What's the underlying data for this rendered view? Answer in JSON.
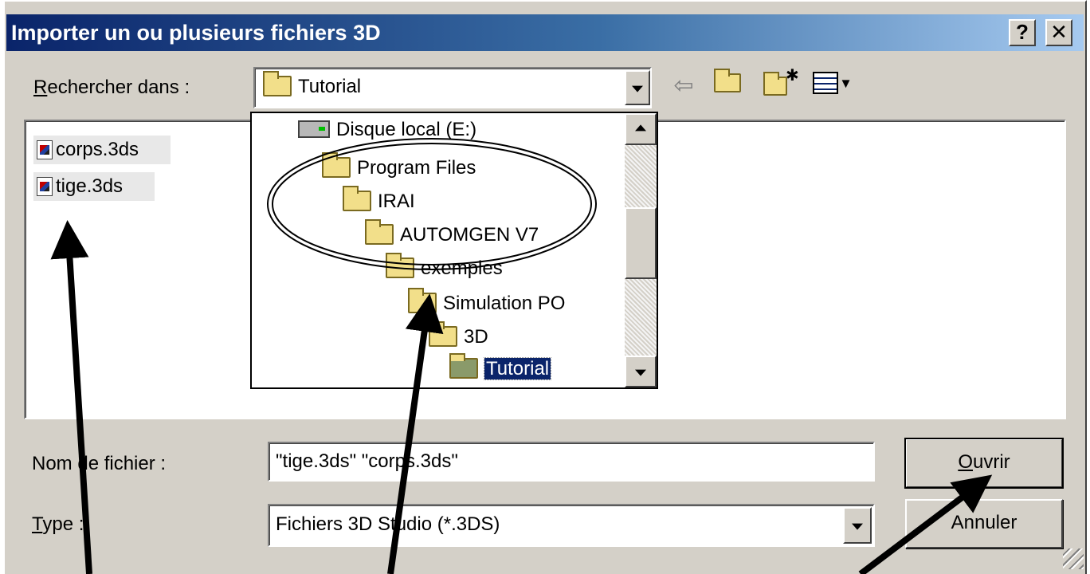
{
  "window": {
    "title": "Importer un ou plusieurs fichiers 3D",
    "help_label": "?",
    "close_label": "✕"
  },
  "lookin": {
    "label_underlined": "R",
    "label_rest": "echercher dans :",
    "value": "Tutorial"
  },
  "toolbar": {
    "back_icon": "back-arrow-icon",
    "up_icon": "folder-up-icon",
    "new_folder_icon": "new-folder-icon",
    "view_menu_icon": "view-menu-icon",
    "back_glyph": "⇦",
    "new_folder_glyph": "✱",
    "view_glyph": "▾"
  },
  "files": [
    {
      "name": "corps.3ds"
    },
    {
      "name": "tige.3ds"
    }
  ],
  "dropdown": {
    "items": [
      {
        "label": "Disque local (E:)",
        "icon": "drive-icon"
      },
      {
        "label": "Program Files",
        "icon": "folder-icon"
      },
      {
        "label": "IRAI",
        "icon": "folder-icon"
      },
      {
        "label": "AUTOMGEN V7",
        "icon": "folder-icon"
      },
      {
        "label": "exemples",
        "icon": "folder-icon"
      },
      {
        "label": "Simulation PO",
        "icon": "folder-icon"
      },
      {
        "label": "3D",
        "icon": "folder-icon"
      },
      {
        "label": "Tutorial",
        "icon": "open-folder-icon",
        "selected": true
      }
    ]
  },
  "filename": {
    "label": "Nom de fichier :",
    "value": "\"tige.3ds\" \"corps.3ds\""
  },
  "filetype": {
    "label_underlined": "T",
    "label_rest": "ype :",
    "value": "Fichiers 3D Studio (*.3DS)"
  },
  "buttons": {
    "open_underlined": "O",
    "open_rest": "uvrir",
    "cancel": "Annuler"
  },
  "colors": {
    "title_start": "#0a246a",
    "title_end": "#a6caf0",
    "face": "#d4d0c8",
    "selection": "#0a246a"
  }
}
